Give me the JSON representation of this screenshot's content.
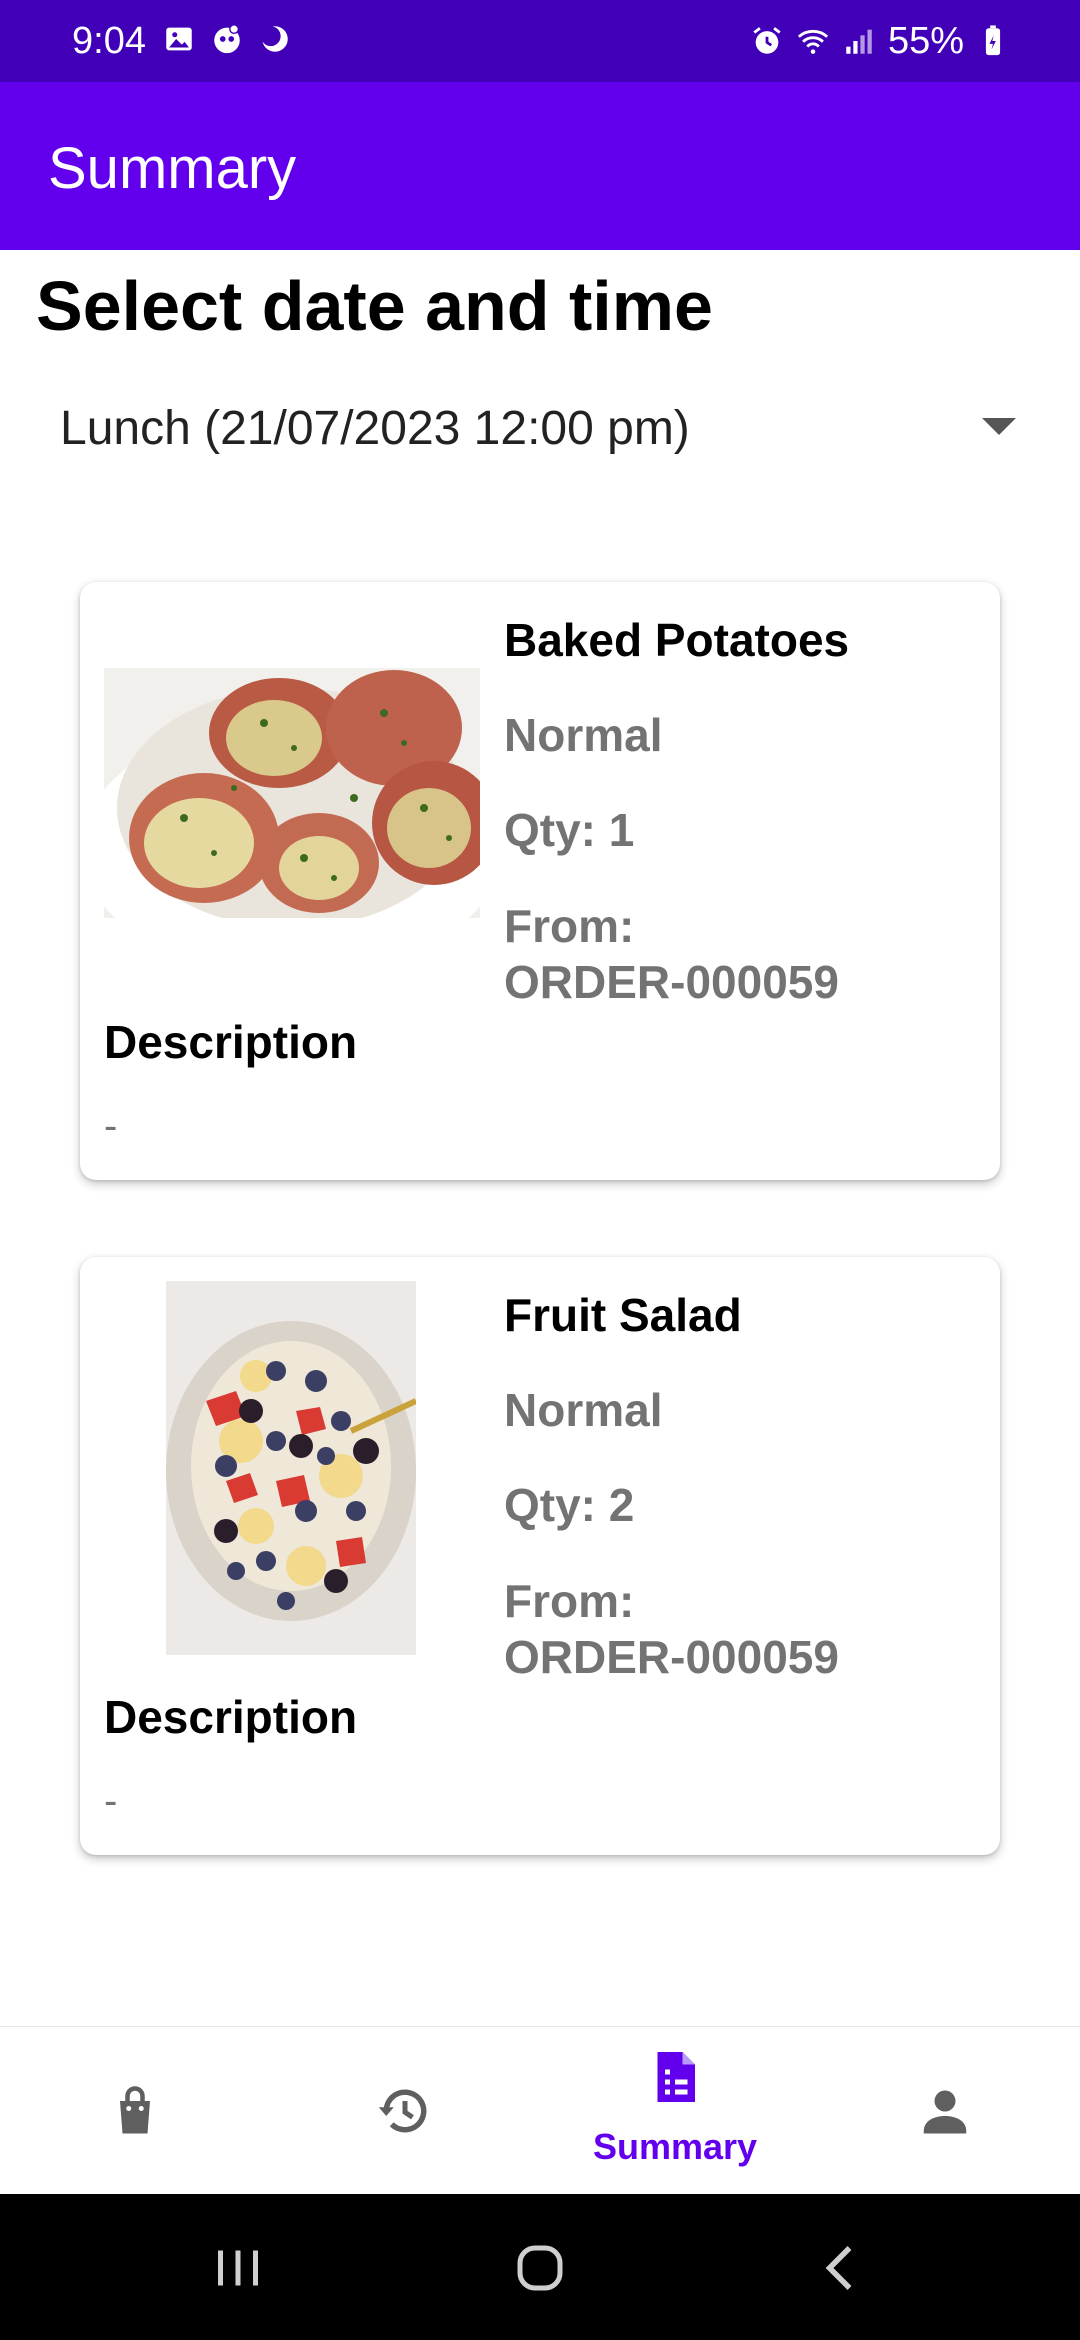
{
  "status_bar": {
    "time": "9:04",
    "battery": "55%",
    "left_icons": [
      "gallery-icon",
      "notification-icon",
      "moon-icon"
    ],
    "right_icons": [
      "alarm-icon",
      "wifi-icon",
      "signal-icon",
      "battery-icon"
    ]
  },
  "app_bar": {
    "title": "Summary"
  },
  "page": {
    "section_title": "Select date and time",
    "meal_select": {
      "value": "Lunch (21/07/2023 12:00 pm)"
    }
  },
  "items": [
    {
      "name": "Baked Potatoes",
      "type": "Normal",
      "qty": "Qty: 1",
      "from_label": "From:",
      "from_value": "ORDER-000059",
      "description_label": "Description",
      "description": "-"
    },
    {
      "name": "Fruit Salad",
      "type": "Normal",
      "qty": "Qty: 2",
      "from_label": "From:",
      "from_value": "ORDER-000059",
      "description_label": "Description",
      "description": "-"
    }
  ],
  "bottom_nav": {
    "active": "Summary",
    "items": [
      {
        "icon": "shopping-bag-icon"
      },
      {
        "icon": "history-icon"
      },
      {
        "icon": "summary-document-icon",
        "label": "Summary"
      },
      {
        "icon": "person-icon"
      }
    ]
  },
  "colors": {
    "status_bar": "#4100b8",
    "primary": "#6200ee",
    "secondary_text": "#737373",
    "inactive_icon": "#5f5f5f"
  }
}
